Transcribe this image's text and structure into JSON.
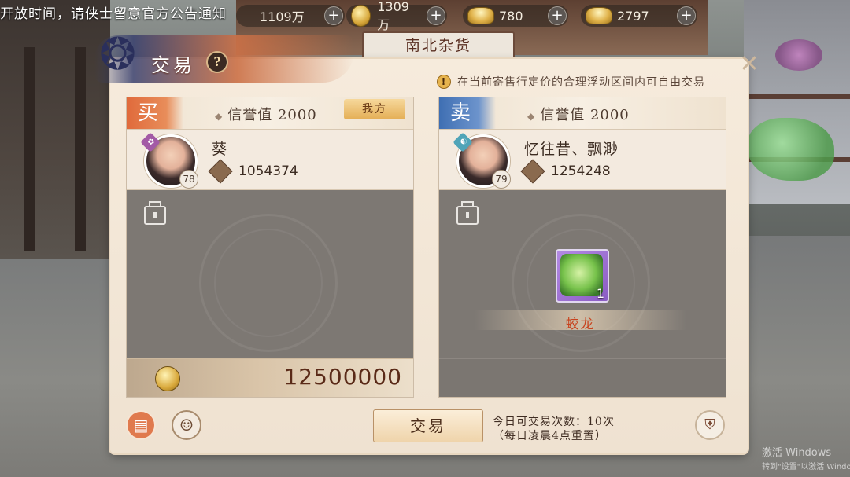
{
  "top_bar": {
    "notice": "开放时间，请侠士留意官方公告通知",
    "resources": [
      {
        "icon": "silver-coin-icon",
        "value": "1109万"
      },
      {
        "icon": "gold-coin-icon",
        "value": "1309万"
      },
      {
        "icon": "ingot-icon",
        "value": "780"
      },
      {
        "icon": "gold-ingot-icon",
        "value": "2797"
      }
    ],
    "add_label": "+"
  },
  "scene": {
    "sign": "南北杂货"
  },
  "panel": {
    "title": "交易",
    "help": "?",
    "tip": "在当前寄售行定价的合理浮动区间内可自由交易",
    "buyer": {
      "tag": "买",
      "credit": "信誉值 2000",
      "mine_label": "我方",
      "name": "葵",
      "level": "78",
      "score": "1054374",
      "money": "12500000"
    },
    "seller": {
      "tag": "卖",
      "credit": "信誉值 2000",
      "name": "忆往昔、飘渺",
      "level": "79",
      "score": "1254248",
      "item": {
        "name": "蛟龙",
        "quantity": "1"
      }
    },
    "trade_button": "交易",
    "trade_info_line1": "今日可交易次数：10次",
    "trade_info_line2": "（每日凌晨4点重置）"
  },
  "watermark": {
    "line1": "激活 Windows",
    "line2": "转到\"设置\"以激活 Windows。"
  }
}
